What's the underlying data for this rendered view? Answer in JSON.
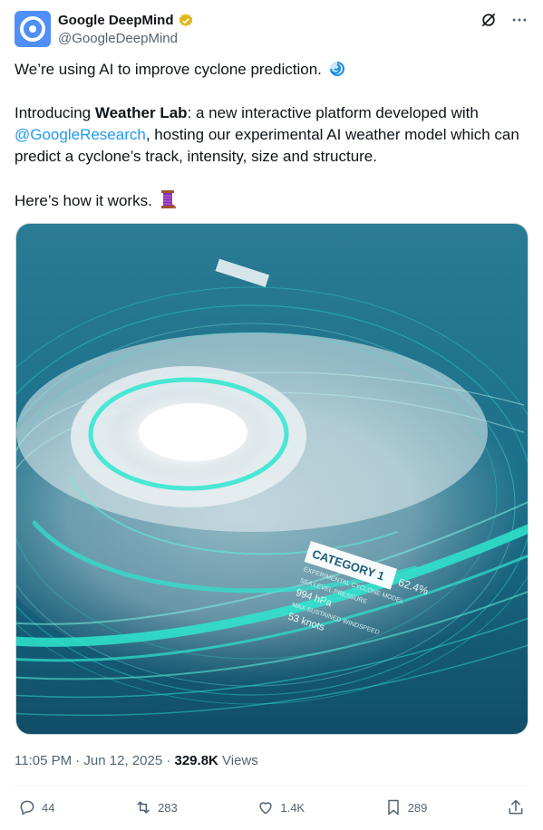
{
  "author": {
    "name": "Google DeepMind",
    "handle": "@GoogleDeepMind"
  },
  "tweet": {
    "line1": "We’re using AI to improve cyclone prediction.",
    "para2_prefix": "Introducing ",
    "para2_bold": "Weather Lab",
    "para2_mid": ": a new interactive platform developed with ",
    "para2_mention": "@GoogleResearch",
    "para2_suffix": ", hosting our experimental AI weather model which can predict a cyclone’s track, intensity, size and structure.",
    "para3": "Here’s how it works."
  },
  "media": {
    "card_title": "CATEGORY 1",
    "card_percent": "62.4%",
    "card_model": "EXPERIMENTAL CYCLONE MODEL",
    "card_pressure_label": "SEA LEVEL PRESSURE",
    "card_pressure_value": "994 hPa",
    "card_wind_label": "MAX SUSTAINED WINDSPEED",
    "card_wind_value": "53 knots",
    "colors": {
      "ocean": "#1a6f8a",
      "accent": "#2ee6cf"
    }
  },
  "meta": {
    "time": "11:05 PM · Jun 12, 2025 · ",
    "views_count": "329.8K",
    "views_label": " Views"
  },
  "actions": {
    "replies": "44",
    "reposts": "283",
    "likes": "1.4K",
    "bookmarks": "289"
  }
}
